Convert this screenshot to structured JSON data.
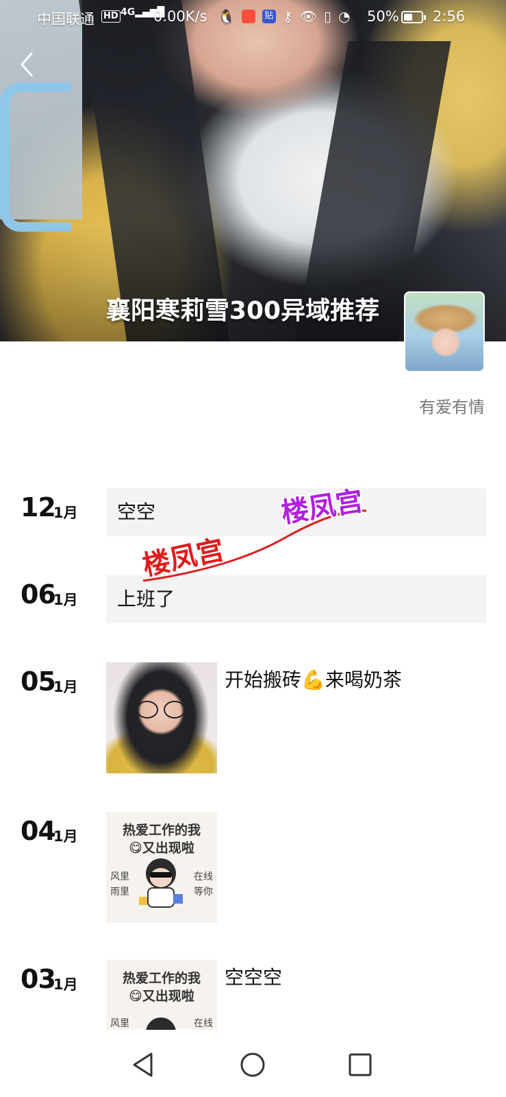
{
  "status_bar": {
    "carrier": "中国联通",
    "hd": "HD",
    "network": "4G",
    "speed": "0.00K/s",
    "battery": "50%",
    "time": "2:56",
    "icons": [
      "qq-icon",
      "taobao-icon",
      "tieba-icon",
      "key-icon",
      "eye-icon",
      "vibrate-icon",
      "speedometer-icon"
    ]
  },
  "header": {
    "title": "襄阳寒莉雪300异域推荐",
    "signature": "有爱有情"
  },
  "watermark": {
    "text_1": "楼凤宫",
    "text_2": "楼凤宫",
    "color_1": "#e01a1a",
    "color_2": "#b01ee0"
  },
  "posts": [
    {
      "day": "12",
      "month": "1月",
      "kind": "text",
      "text": "空空"
    },
    {
      "day": "06",
      "month": "1月",
      "kind": "text",
      "text": "上班了"
    },
    {
      "day": "05",
      "month": "1月",
      "kind": "image",
      "caption": "开始搬砖💪来喝奶茶"
    },
    {
      "day": "04",
      "month": "1月",
      "kind": "sticker",
      "caption": "",
      "sticker": {
        "line1": "热爱工作的我",
        "line2": "😋又出现啦",
        "left": "风里\n雨里",
        "right": "在线\n等你"
      }
    },
    {
      "day": "03",
      "month": "1月",
      "kind": "sticker",
      "caption": "空空空",
      "sticker": {
        "line1": "热爱工作的我",
        "line2": "😋又出现啦",
        "left": "风里",
        "right": "在线"
      }
    }
  ],
  "colors": {
    "card_bg": "#f3f3f3",
    "signature": "#777777",
    "background": "#ffffff"
  }
}
